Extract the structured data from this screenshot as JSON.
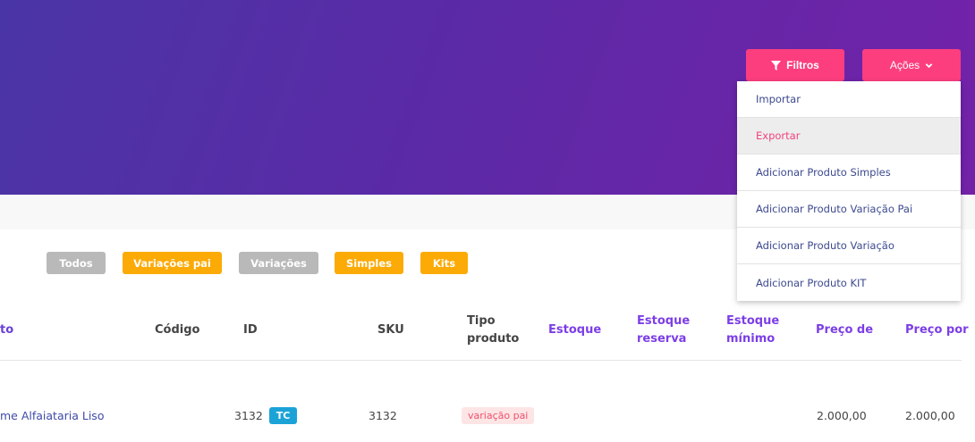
{
  "header": {
    "filtros_label": "Filtros",
    "acoes_label": "Ações"
  },
  "actions_menu": {
    "items": [
      "Importar",
      "Exportar",
      "Adicionar Produto Simples",
      "Adicionar Produto Variação Pai",
      "Adicionar Produto Variação",
      "Adicionar Produto KIT"
    ],
    "active_item": "Exportar"
  },
  "filters": {
    "chips": [
      "Todos",
      "Variações pai",
      "Variações",
      "Simples",
      "Kits"
    ]
  },
  "table": {
    "headers": {
      "produto": "to",
      "codigo": "Código",
      "id": "ID",
      "sku": "SKU",
      "tipo_1": "Tipo",
      "tipo_2": "produto",
      "estoque": "Estoque",
      "estoque_reserva_1": "Estoque",
      "estoque_reserva_2": "reserva",
      "estoque_minimo_1": "Estoque",
      "estoque_minimo_2": "mínimo",
      "preco_de": "Preço de",
      "preco_por": "Preço por"
    },
    "rows": [
      {
        "produto": "me Alfaiataria Liso",
        "id": "3132",
        "id_tag": "TC",
        "sku": "3132",
        "tipo": "variação pai",
        "preco_de": "2.000,00",
        "preco_por": "2.000,00"
      }
    ]
  },
  "colors": {
    "accent_pink": "#fc3e7f",
    "header_gradient_start": "#4a35a6",
    "header_gradient_end": "#7322a8",
    "chip_gray": "#b9b9b9",
    "chip_orange": "#fcaa06",
    "tag_blue": "#1ba3d8"
  }
}
